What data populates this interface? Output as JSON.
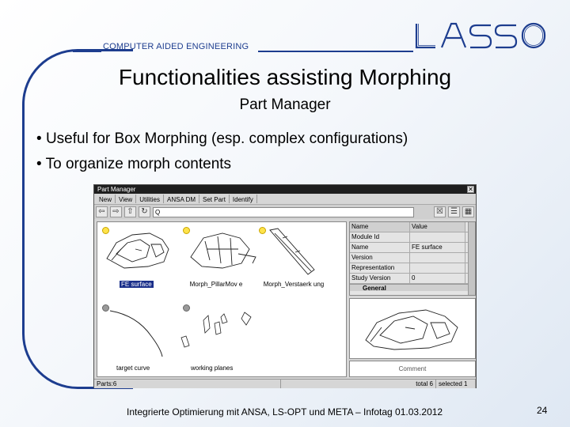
{
  "header": {
    "section_label": "COMPUTER AIDED ENGINEERING",
    "logo_text": "LASSO"
  },
  "slide": {
    "title": "Functionalities assisting Morphing",
    "subtitle": "Part Manager",
    "bullets": [
      "Useful for Box Morphing (esp. complex configurations)",
      "To organize morph contents"
    ]
  },
  "window": {
    "title": "Part Manager",
    "menu": [
      "New",
      "View",
      "Utilities",
      "ANSA DM",
      "Set Part",
      "Identify"
    ],
    "search_placeholder": "Q",
    "parts": [
      {
        "label": "FE surface",
        "selected": true,
        "visible": true
      },
      {
        "label": "Morph_PillarMov e",
        "selected": false,
        "visible": true
      },
      {
        "label": "Morph_Verstaerk ung",
        "selected": false,
        "visible": true
      },
      {
        "label": "target curve",
        "selected": false,
        "visible": false
      },
      {
        "label": "working planes",
        "selected": false,
        "visible": false
      }
    ],
    "properties": {
      "headers": [
        "Name",
        "Value"
      ],
      "rows": [
        {
          "name": "Module Id",
          "value": ""
        },
        {
          "name": "Name",
          "value": "FE surface"
        },
        {
          "name": "Version",
          "value": ""
        },
        {
          "name": "Representation",
          "value": ""
        },
        {
          "name": "Study Version",
          "value": "0"
        }
      ],
      "group": "General"
    },
    "comment_label": "Comment",
    "status": [
      "Parts:6",
      "total 6",
      "selected 1"
    ]
  },
  "footer": {
    "text": "Integrierte Optimierung mit ANSA, LS-OPT und META – Infotag 01.03.2012",
    "page_number": "24"
  },
  "colors": {
    "accent": "#1d3d8f",
    "selection": "#1a2f8a"
  }
}
